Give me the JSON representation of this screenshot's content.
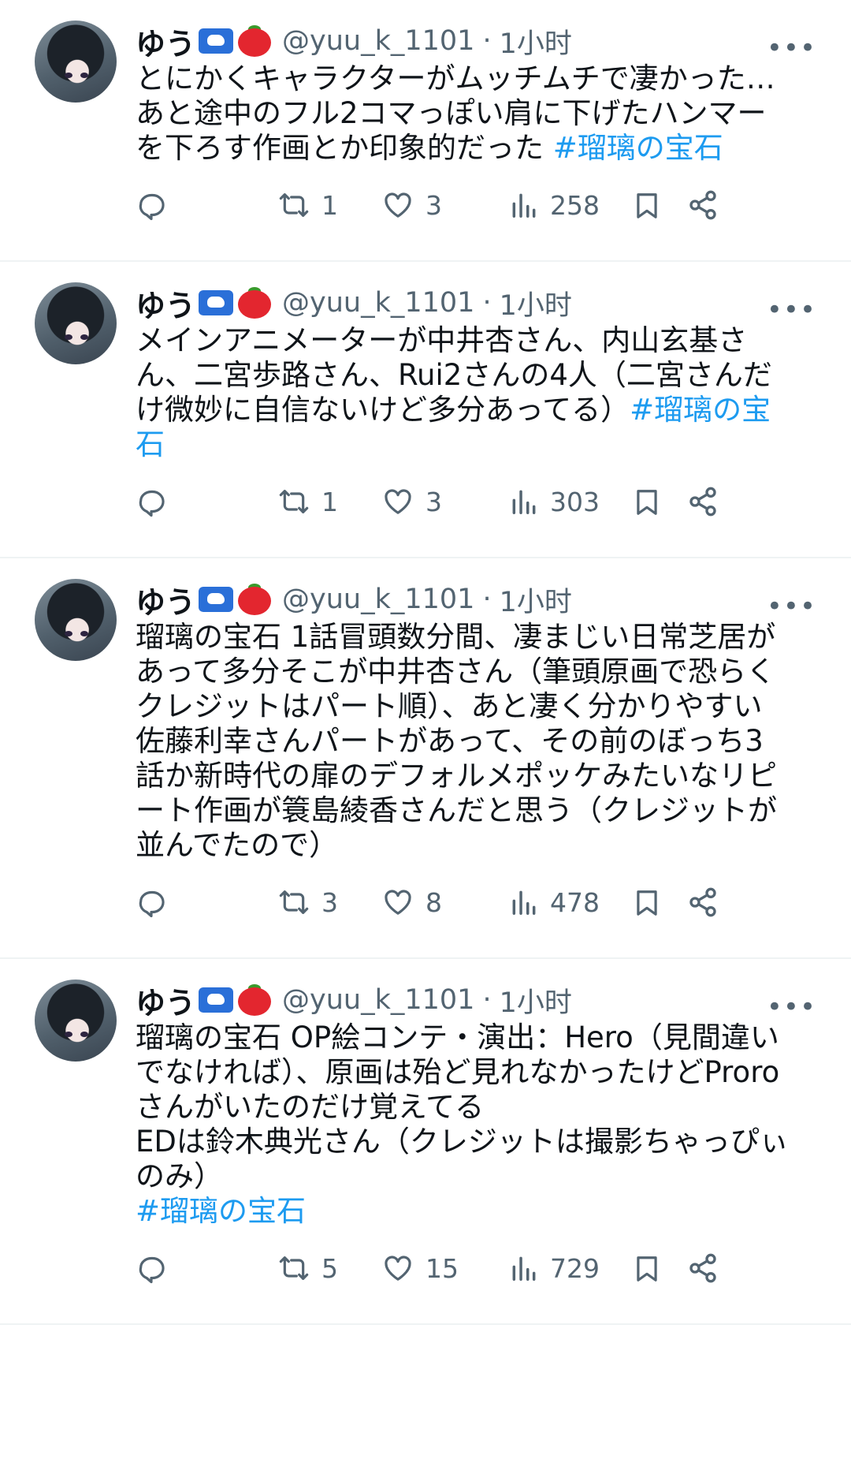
{
  "tweets": [
    {
      "name": "ゆう",
      "handle": "@yuu_k_1101",
      "sep": "·",
      "time": "1小时",
      "more": "•••",
      "text": "とにかくキャラクターがムッチムチで凄かった…\nあと途中のフル2コマっぽい肩に下げたハンマー\nを下ろす作画とか印象的だった ",
      "tag": "#瑠璃の宝石",
      "retweets": "1",
      "likes": "3",
      "views": "258"
    },
    {
      "name": "ゆう",
      "handle": "@yuu_k_1101",
      "sep": "·",
      "time": "1小时",
      "more": "•••",
      "text": "メインアニメーターが中井杏さん、内山玄基さ\nん、二宮歩路さん、Rui2さんの4人（二宮さんだ\nけ微妙に自信ないけど多分あってる）",
      "tag": "#瑠璃の宝\n石",
      "retweets": "1",
      "likes": "3",
      "views": "303"
    },
    {
      "name": "ゆう",
      "handle": "@yuu_k_1101",
      "sep": "·",
      "time": "1小时",
      "more": "•••",
      "text": "瑠璃の宝石 1話冒頭数分間、凄まじい日常芝居が\nあって多分そこが中井杏さん（筆頭原画で恐らく\nクレジットはパート順）、あと凄く分かりやすい\n佐藤利幸さんパートがあって、その前のぼっち3\n話か新時代の扉のデフォルメポッケみたいなリピ\nート作画が簑島綾香さんだと思う（クレジットが\n並んでたので）",
      "tag": "",
      "retweets": "3",
      "likes": "8",
      "views": "478"
    },
    {
      "name": "ゆう",
      "handle": "@yuu_k_1101",
      "sep": "·",
      "time": "1小时",
      "more": "•••",
      "text": "瑠璃の宝石 OP絵コンテ・演出：Hero（見間違い\nでなければ）、原画は殆ど見れなかったけどProro\nさんがいたのだけ覚えてる\nEDは鈴木典光さん（クレジットは撮影ちゃっぴぃ\nのみ）\n",
      "tag": "#瑠璃の宝石",
      "retweets": "5",
      "likes": "15",
      "views": "729"
    }
  ],
  "icons": {
    "reply": "speech-bubble-icon",
    "retweet": "repost-arrows-icon",
    "like": "heart-icon",
    "views": "bar-chart-icon",
    "bookmark": "bookmark-icon",
    "share": "share-nodes-icon"
  },
  "colors": {
    "text": "#0f1419",
    "secondary": "#536471",
    "link": "#1d9bf0",
    "divider": "#eff3f4"
  }
}
